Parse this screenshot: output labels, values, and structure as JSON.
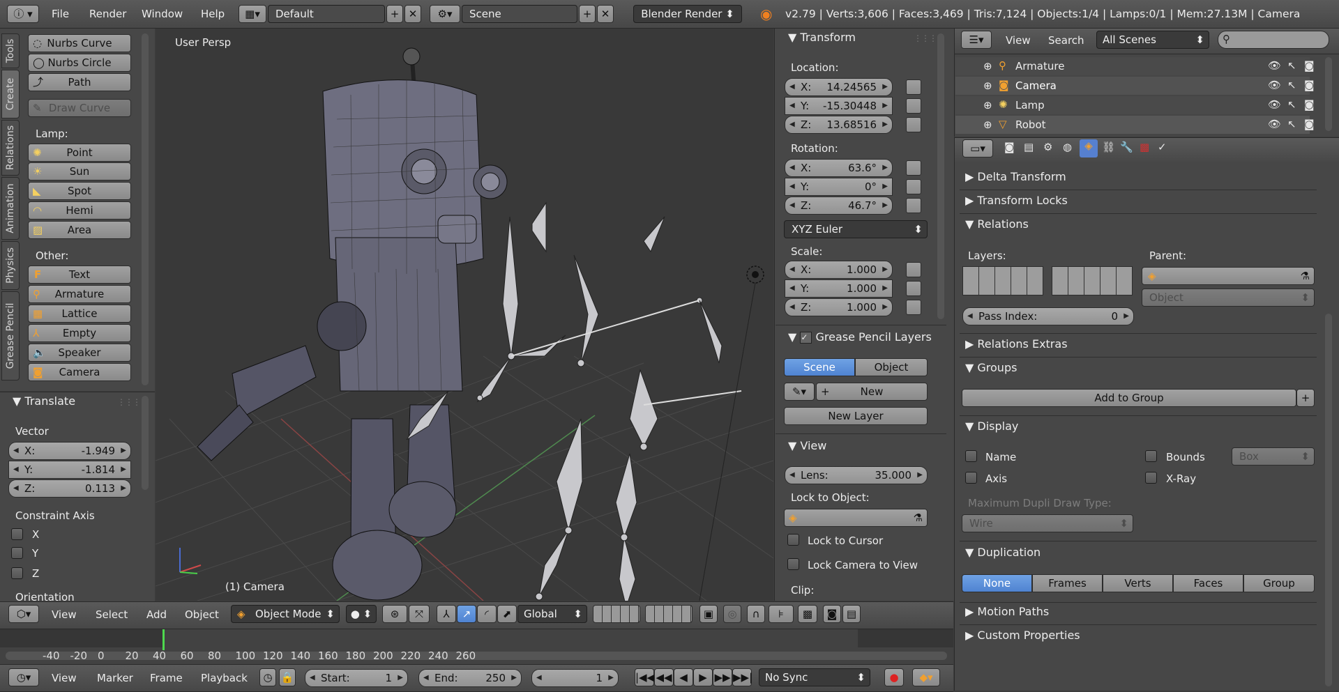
{
  "topbar": {
    "menus": [
      "File",
      "Render",
      "Window",
      "Help"
    ],
    "screen_layout": "Default",
    "scene": "Scene",
    "render_engine": "Blender Render",
    "stats": "v2.79 | Verts:3,606 | Faces:3,469 | Tris:7,124 | Objects:1/4 | Lamps:0/1 | Mem:27.13M | Camera"
  },
  "toolshelf": {
    "tabs": [
      "Tools",
      "Create",
      "Relations",
      "Animation",
      "Physics",
      "Grease Pencil"
    ],
    "active_tab": "Create",
    "curve_buttons": [
      "Nurbs Curve",
      "Nurbs Circle",
      "Path"
    ],
    "draw_curve": "Draw Curve",
    "lamp_label": "Lamp:",
    "lamp_buttons": [
      "Point",
      "Sun",
      "Spot",
      "Hemi",
      "Area"
    ],
    "other_label": "Other:",
    "other_buttons": [
      "Text",
      "Armature",
      "Lattice",
      "Empty",
      "Speaker",
      "Camera"
    ]
  },
  "operator": {
    "title": "Translate",
    "vector_label": "Vector",
    "x_label": "X:",
    "x": "-1.949",
    "y_label": "Y:",
    "y": "-1.814",
    "z_label": "Z:",
    "z": "0.113",
    "constraint_label": "Constraint Axis",
    "axes": [
      "X",
      "Y",
      "Z"
    ],
    "orientation_label": "Orientation"
  },
  "viewport": {
    "view_name": "User Persp",
    "object_name": "(1) Camera"
  },
  "properties_n": {
    "transform_title": "Transform",
    "location_label": "Location:",
    "loc_x": "14.24565",
    "loc_y": "-15.30448",
    "loc_z": "13.68516",
    "rotation_label": "Rotation:",
    "rot_x": "63.6°",
    "rot_y": "0°",
    "rot_z": "46.7°",
    "rotation_mode": "XYZ Euler",
    "scale_label": "Scale:",
    "scale_x": "1.000",
    "scale_y": "1.000",
    "scale_z": "1.000",
    "gp_title": "Grease Pencil Layers",
    "gp_scene": "Scene",
    "gp_object": "Object",
    "gp_new": "New",
    "gp_new_layer": "New Layer",
    "view_title": "View",
    "lens_label": "Lens:",
    "lens": "35.000",
    "lock_object_label": "Lock to Object:",
    "lock_cursor": "Lock to Cursor",
    "lock_camera": "Lock Camera to View",
    "clip_label": "Clip:",
    "axis_x": "X:",
    "axis_y": "Y:",
    "axis_z": "Z:"
  },
  "view3d_header": {
    "menus": [
      "View",
      "Select",
      "Add",
      "Object"
    ],
    "mode": "Object Mode",
    "orientation": "Global"
  },
  "timeline": {
    "ticks": [
      "-40",
      "-20",
      "0",
      "20",
      "40",
      "60",
      "80",
      "100",
      "120",
      "140",
      "160",
      "180",
      "200",
      "220",
      "240",
      "260"
    ],
    "menus": [
      "View",
      "Marker",
      "Frame",
      "Playback"
    ],
    "start_label": "Start:",
    "start": "1",
    "end_label": "End:",
    "end": "250",
    "current": "1",
    "sync": "No Sync"
  },
  "outliner": {
    "menus": [
      "View",
      "Search"
    ],
    "filter": "All Scenes",
    "items": [
      "Armature",
      "Camera",
      "Lamp",
      "Robot"
    ]
  },
  "properties": {
    "panels_collapsed_top": [
      "Delta Transform",
      "Transform Locks"
    ],
    "relations_title": "Relations",
    "layers_label": "Layers:",
    "parent_label": "Parent:",
    "parent_type": "Object",
    "pass_index_label": "Pass Index:",
    "pass_index": "0",
    "relations_extras": "Relations Extras",
    "groups_title": "Groups",
    "add_to_group": "Add to Group",
    "display_title": "Display",
    "display_name": "Name",
    "display_axis": "Axis",
    "display_bounds": "Bounds",
    "display_xray": "X-Ray",
    "bounds_type": "Box",
    "dupli_label": "Maximum Dupli Draw Type:",
    "dupli_value": "Wire",
    "duplication_title": "Duplication",
    "duplication_options": [
      "None",
      "Frames",
      "Verts",
      "Faces",
      "Group"
    ],
    "duplication_active": "None",
    "motion_paths": "Motion Paths",
    "custom_properties": "Custom Properties"
  },
  "colors": {
    "accent": "#5680d0",
    "background": "#3d3d3d",
    "viewport": "#393939",
    "selected": "#ff8c1a"
  }
}
